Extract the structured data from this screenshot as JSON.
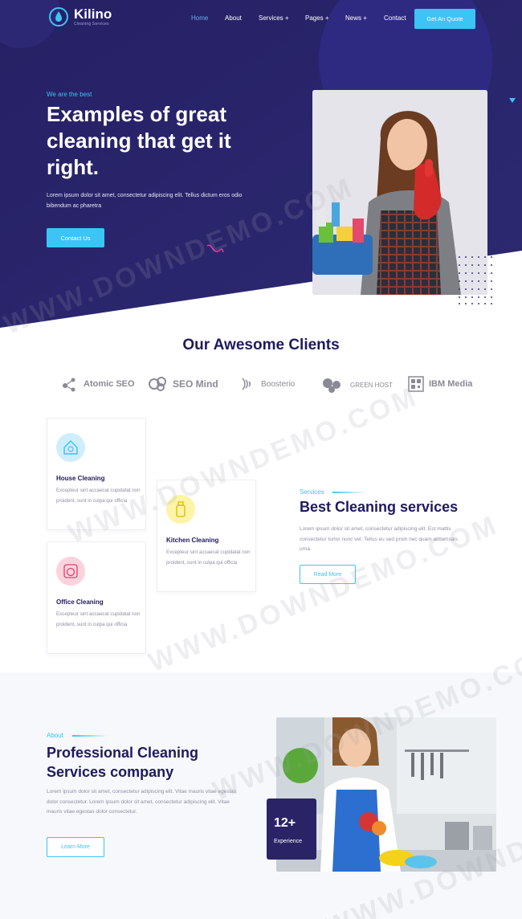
{
  "brand": {
    "name": "Kilino",
    "tagline": "Cleaning Services",
    "accent": "#3cc4f4",
    "navy": "#2a2467"
  },
  "nav": {
    "items": [
      "Home",
      "About",
      "Services +",
      "Pages +",
      "News +",
      "Contact"
    ],
    "cta": "Get An Quote"
  },
  "hero": {
    "eyebrow": "We are the best",
    "title": "Examples of great cleaning that get it right.",
    "text": "Lorem ipsum dolor sit amet, consectetur adipiscing elit. Tellus dictum eros odio bibendum ac pharetra",
    "button": "Contact Us"
  },
  "clients": {
    "title": "Our Awesome Clients",
    "logos": [
      "Atomic SEO",
      "SEO Mind",
      "Boosterio",
      "GREEN HOST",
      "IBM Media"
    ]
  },
  "services": {
    "cards": [
      {
        "title": "House Cleaning",
        "desc": "Excepteur sint accaecat cupidatat non proident, sunt in culpa qui officia",
        "icon": "house-icon"
      },
      {
        "title": "Kitchen Cleaning",
        "desc": "Excepteur sint accaecat cupidatat non proident, sunt in culpa qui officia",
        "icon": "bottle-icon"
      },
      {
        "title": "Office Cleaning",
        "desc": "Excepteur sint accaecat cupidatat non proident, sunt in culpa qui officia",
        "icon": "washer-icon"
      }
    ],
    "eyebrow": "Services",
    "heading": "Best Cleaning services",
    "text": "Lorem ipsum dolor sit amet, consectetur adipiscing elit. Est mattis consectetur tortor nunc vel. Tellus eu sed proin nec quam accumsan, urna.",
    "button": "Read More"
  },
  "about": {
    "eyebrow": "About",
    "title": "Professional Cleaning Services company",
    "text": "Lorem ipsum dolor sit amet, consectetur adipiscing elit. Vitae mauris vitae egestas dolor consectetur. Lorem ipsum dolor sit amet, consectetur adipiscing elit. Vitae mauris vitae egestas dolor consectetur.",
    "button": "Learn More",
    "experience": {
      "number": "12+",
      "label": "Experience"
    }
  },
  "watermark": "WWW.DOWNDEMO.COM"
}
